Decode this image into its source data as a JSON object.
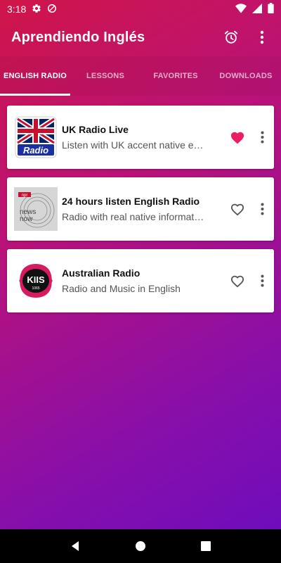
{
  "status_bar": {
    "time": "3:18"
  },
  "app_bar": {
    "title": "Aprendiendo Inglés"
  },
  "tabs": [
    {
      "label": "ENGLISH RADIO",
      "active": true
    },
    {
      "label": "LESSONS",
      "active": false
    },
    {
      "label": "FAVORITES",
      "active": false
    },
    {
      "label": "DOWNLOADS",
      "active": false
    }
  ],
  "stations": [
    {
      "title": "UK Radio Live",
      "subtitle": "Listen with UK accent native e…",
      "favorite": true,
      "logo": "uk-flag-radio-logo",
      "logo_text": "Radio"
    },
    {
      "title": "24 hours listen English Radio",
      "subtitle": "Radio with real native informat…",
      "favorite": false,
      "logo": "npr-news-now-logo",
      "logo_text": [
        "npr",
        "news",
        "now"
      ]
    },
    {
      "title": "Australian Radio",
      "subtitle": "Radio and Music in English",
      "favorite": false,
      "logo": "kiis-logo",
      "logo_text": [
        "KIIS",
        "1065"
      ]
    }
  ],
  "colors": {
    "favorite_active": "#e91e63",
    "favorite_inactive": "#555555",
    "gradient_start": "#d01549",
    "gradient_end": "#6a0cc0"
  }
}
